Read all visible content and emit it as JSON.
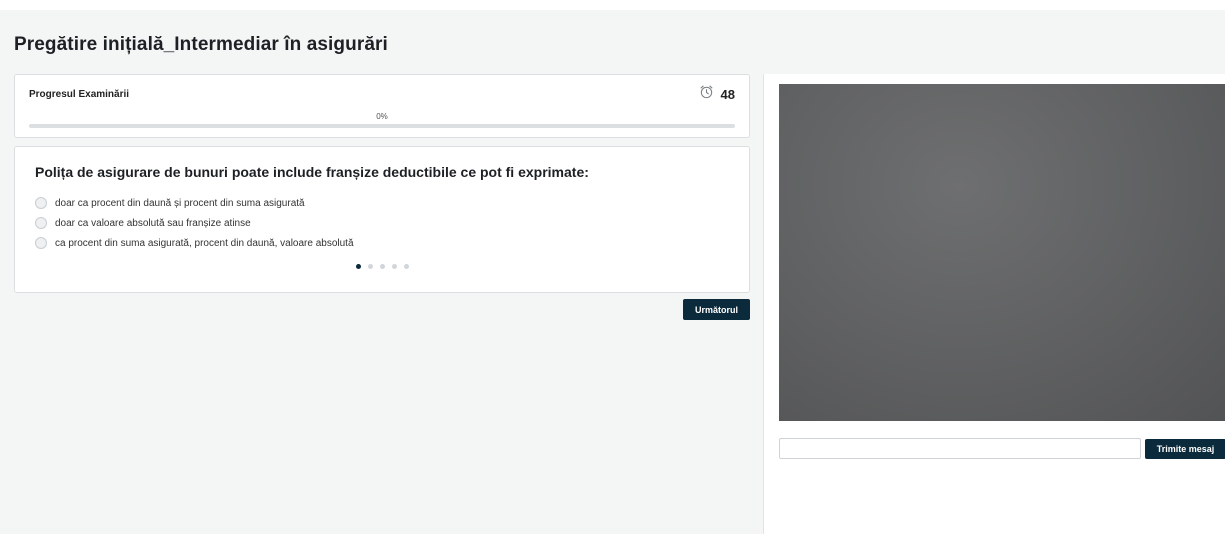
{
  "page": {
    "title": "Pregătire inițială_Intermediar în asigurări"
  },
  "progress": {
    "label": "Progresul Examinării",
    "timer_icon": "alarm-clock-icon",
    "timer_value": "48",
    "percent_text": "0%",
    "fraction": 0
  },
  "question": {
    "text": "Polița de asigurare de bunuri poate include franșize deductibile ce pot fi exprimate:",
    "options": [
      {
        "label": "doar ca procent din daună și procent din suma asigurată"
      },
      {
        "label": "doar ca valoare absolută sau franșize atinse"
      },
      {
        "label": "ca procent din suma asigurată, procent din daună, valoare absolută"
      }
    ],
    "pagination": {
      "total": 5,
      "current": 1
    }
  },
  "actions": {
    "next_label": "Următorul"
  },
  "chat": {
    "input_value": "",
    "send_label": "Trimite mesaj"
  },
  "colors": {
    "accent": "#0b2a3c",
    "background": "#f4f5f5"
  }
}
